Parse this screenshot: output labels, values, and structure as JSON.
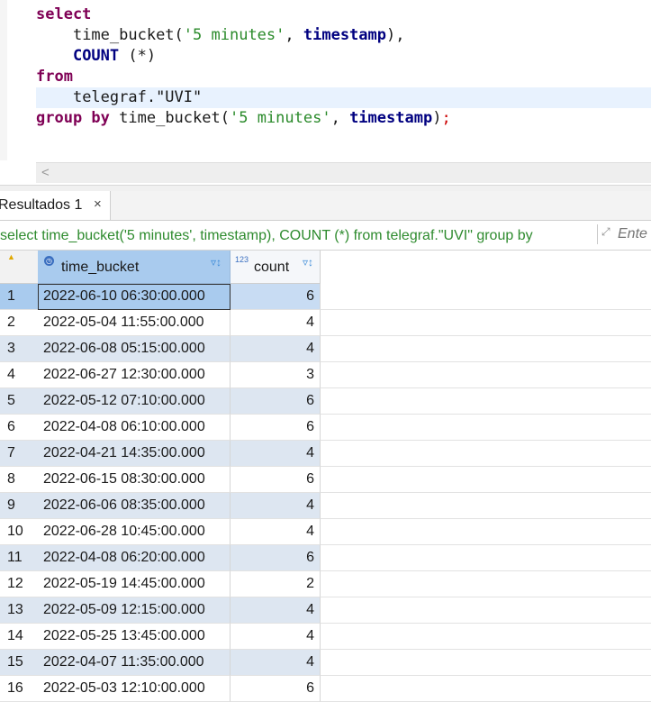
{
  "editor": {
    "line1": "select",
    "line2_fn": "time_bucket",
    "line2_str": "'5 minutes'",
    "line2_id": "timestamp",
    "line3_fn": "COUNT",
    "line3_rest": " (*)",
    "line4": "from",
    "line5": "telegraf.\"UVI\"",
    "line6_kw": "group by",
    "line6_fn": "time_bucket",
    "line6_str": "'5 minutes'",
    "line6_id": "timestamp",
    "scroll_left": "<"
  },
  "tab": {
    "label": "Resultados 1",
    "close": "×"
  },
  "query": {
    "text": "select time_bucket('5 minutes', timestamp), COUNT (*) from telegraf.\"UVI\" group by",
    "filter_placeholder": "Ente"
  },
  "grid": {
    "columns": [
      {
        "label": "time_bucket",
        "type_icon": "clock-icon"
      },
      {
        "label": "count",
        "type_badge": "123"
      }
    ],
    "rows": [
      {
        "n": "1",
        "time_bucket": "2022-06-10 06:30:00.000",
        "count": "6"
      },
      {
        "n": "2",
        "time_bucket": "2022-05-04 11:55:00.000",
        "count": "4"
      },
      {
        "n": "3",
        "time_bucket": "2022-06-08 05:15:00.000",
        "count": "4"
      },
      {
        "n": "4",
        "time_bucket": "2022-06-27 12:30:00.000",
        "count": "3"
      },
      {
        "n": "5",
        "time_bucket": "2022-05-12 07:10:00.000",
        "count": "6"
      },
      {
        "n": "6",
        "time_bucket": "2022-04-08 06:10:00.000",
        "count": "6"
      },
      {
        "n": "7",
        "time_bucket": "2022-04-21 14:35:00.000",
        "count": "4"
      },
      {
        "n": "8",
        "time_bucket": "2022-06-15 08:30:00.000",
        "count": "6"
      },
      {
        "n": "9",
        "time_bucket": "2022-06-06 08:35:00.000",
        "count": "4"
      },
      {
        "n": "10",
        "time_bucket": "2022-06-28 10:45:00.000",
        "count": "4"
      },
      {
        "n": "11",
        "time_bucket": "2022-04-08 06:20:00.000",
        "count": "6"
      },
      {
        "n": "12",
        "time_bucket": "2022-05-19 14:45:00.000",
        "count": "2"
      },
      {
        "n": "13",
        "time_bucket": "2022-05-09 12:15:00.000",
        "count": "4"
      },
      {
        "n": "14",
        "time_bucket": "2022-05-25 13:45:00.000",
        "count": "4"
      },
      {
        "n": "15",
        "time_bucket": "2022-04-07 11:35:00.000",
        "count": "4"
      },
      {
        "n": "16",
        "time_bucket": "2022-05-03 12:10:00.000",
        "count": "6"
      }
    ]
  }
}
